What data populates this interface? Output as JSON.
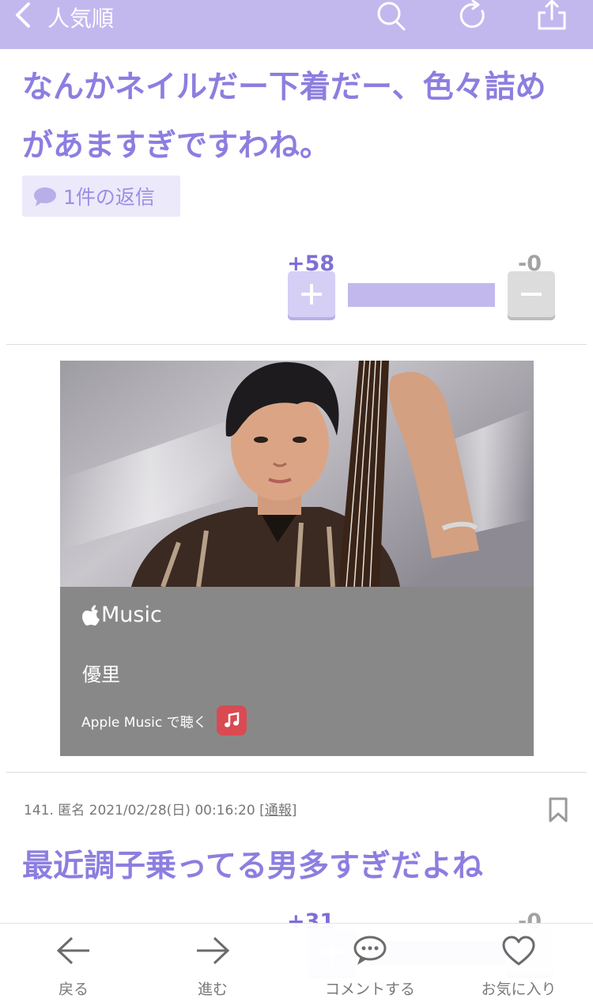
{
  "topbar": {
    "back_label": "人気順",
    "icons": [
      "chevron-left-icon",
      "search-icon",
      "refresh-icon",
      "share-icon"
    ],
    "bg_color": "#c2b8ee"
  },
  "comment1": {
    "body": "なんかネイルだー下着だー、色々詰めがあますぎですわね。",
    "reply_badge": "1件の返信",
    "vote": {
      "plus": "+58",
      "minus": "-0",
      "plus_fraction": 1.0
    }
  },
  "music_card": {
    "brand": "Music",
    "artist": "優里",
    "listen_label": "Apple Music で聴く"
  },
  "comment2": {
    "number": "141.",
    "author": "匿名",
    "datetime": "2021/02/28(日) 00:16:20",
    "report_open": "[",
    "report": "通報",
    "report_close": "]",
    "body": "最近調子乗ってる男多すぎだよね",
    "vote": {
      "plus": "+31",
      "minus": "-0",
      "plus_fraction": 1.0
    }
  },
  "bottom_nav": {
    "items": [
      {
        "label": "戻る",
        "icon": "arrow-left-icon"
      },
      {
        "label": "進む",
        "icon": "arrow-right-icon"
      },
      {
        "label": "コメントする",
        "icon": "speech-bubble-icon"
      },
      {
        "label": "お気に入り",
        "icon": "heart-icon"
      }
    ]
  },
  "colors": {
    "accent": "#8c7ee0",
    "accent_light": "#c2b8ee",
    "card_bg": "#888888"
  }
}
